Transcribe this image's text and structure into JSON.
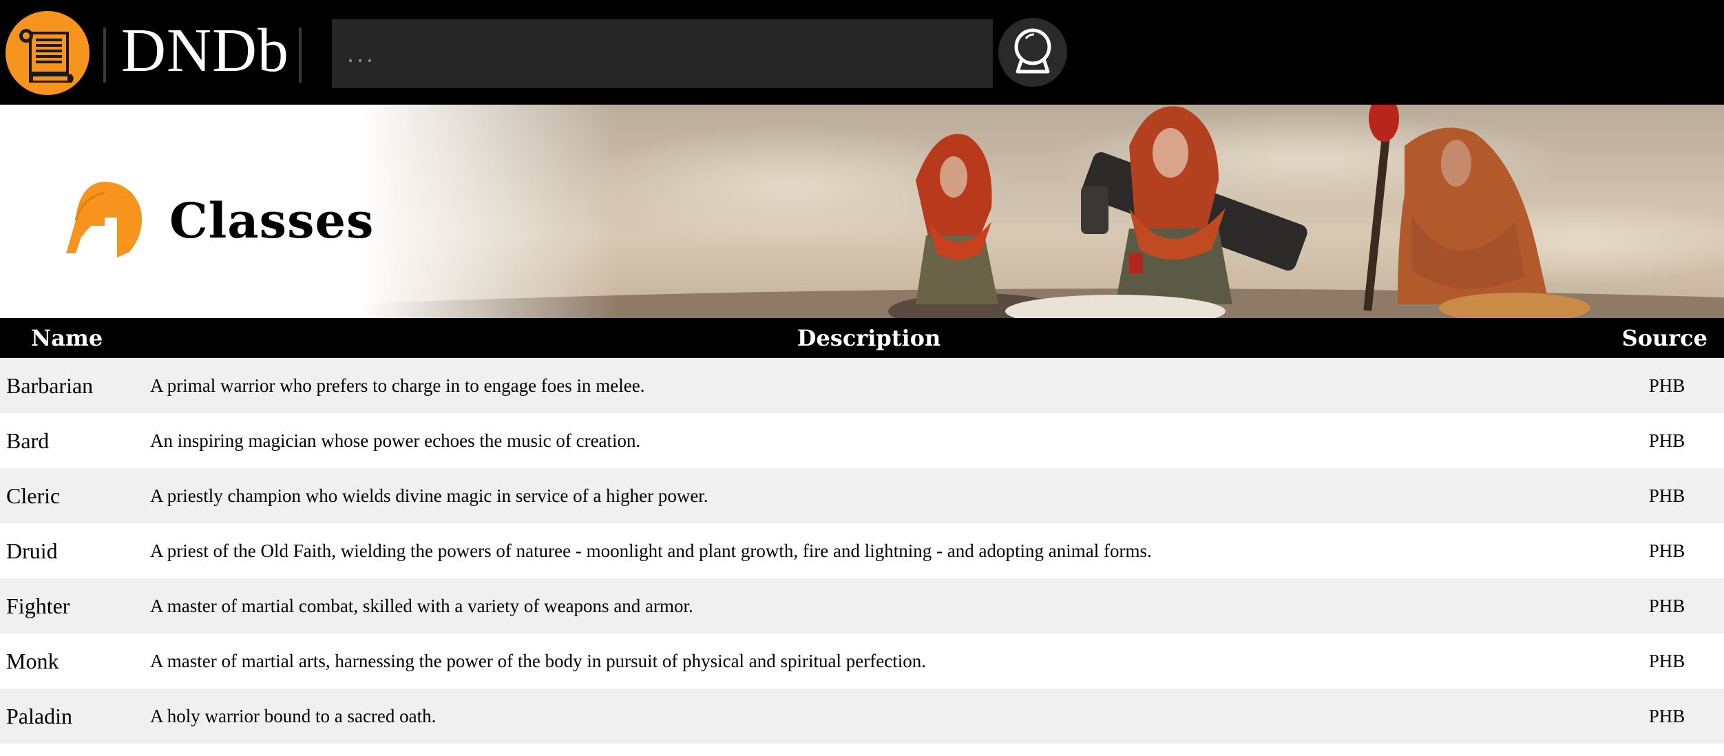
{
  "app": {
    "name": "DNDb",
    "brand_color": "#f7941d",
    "logo_icon": "scroll-icon"
  },
  "search": {
    "placeholder": "...",
    "value": "",
    "button_icon": "crystal-ball-icon"
  },
  "hero": {
    "title": "Classes",
    "icon": "helmet-icon",
    "artwork": "three hooded adventurers artwork"
  },
  "table": {
    "columns": [
      "Name",
      "Description",
      "Source"
    ],
    "rows": [
      {
        "name": "Barbarian",
        "description": "A primal warrior who prefers to charge in to engage foes in melee.",
        "source": "PHB"
      },
      {
        "name": "Bard",
        "description": "An inspiring magician whose power echoes the music of creation.",
        "source": "PHB"
      },
      {
        "name": "Cleric",
        "description": "A priestly champion who wields divine magic in service of a higher power.",
        "source": "PHB"
      },
      {
        "name": "Druid",
        "description": "A priest of the Old Faith, wielding the powers of naturee - moonlight and plant growth, fire and lightning - and adopting animal forms.",
        "source": "PHB"
      },
      {
        "name": "Fighter",
        "description": "A master of martial combat, skilled with a variety of weapons and armor.",
        "source": "PHB"
      },
      {
        "name": "Monk",
        "description": "A master of martial arts, harnessing the power of the body in pursuit of physical and spiritual perfection.",
        "source": "PHB"
      },
      {
        "name": "Paladin",
        "description": "A holy warrior bound to a sacred oath.",
        "source": "PHB"
      }
    ]
  }
}
